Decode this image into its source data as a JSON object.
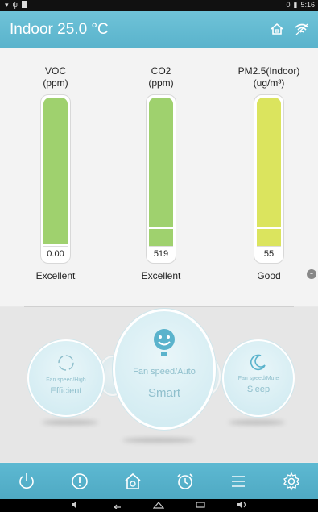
{
  "status": {
    "time": "5:16",
    "notification_count": "0"
  },
  "header": {
    "title": "Indoor 25.0 °C"
  },
  "sensors": [
    {
      "label_line1": "VOC",
      "label_line2": "(ppm)",
      "value": "0.00",
      "rating": "Excellent",
      "fill_color": "#9fd16e",
      "level": 0.0
    },
    {
      "label_line1": "CO2",
      "label_line2": "(ppm)",
      "value": "519",
      "rating": "Excellent",
      "fill_color": "#9fd16e",
      "level": 0.1
    },
    {
      "label_line1": "PM2.5(Indoor)",
      "label_line2": "(ug/m³)",
      "value": "55",
      "rating": "Good",
      "fill_color": "#dbe45e",
      "level": 0.1
    }
  ],
  "modes": {
    "efficient": {
      "small": "Fan speed/High",
      "big": "Efficient"
    },
    "smart": {
      "small": "Fan speed/Auto",
      "big": "Smart"
    },
    "sleep": {
      "small": "Fan speed/Mute",
      "big": "Sleep"
    }
  },
  "bottom_icons": [
    "power-icon",
    "alert-icon",
    "home-icon",
    "alarm-clock-icon",
    "menu-icon",
    "gear-icon"
  ],
  "colors": {
    "accent": "#5ab3cc",
    "good_green": "#9fd16e",
    "good_yellow": "#dbe45e"
  }
}
